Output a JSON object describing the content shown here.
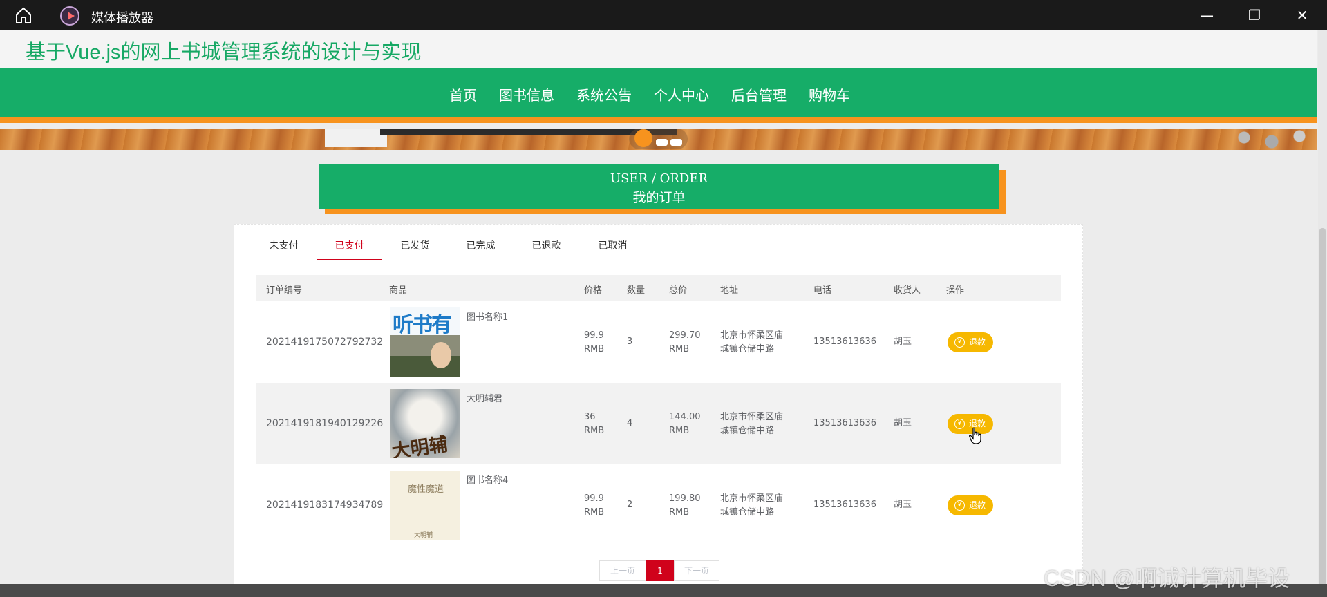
{
  "window": {
    "app_title": "媒体播放器",
    "min_glyph": "—",
    "max_glyph": "❐",
    "close_glyph": "✕"
  },
  "site": {
    "title": "基于Vue.js的网上书城管理系统的设计与实现"
  },
  "nav": {
    "items": [
      "首页",
      "图书信息",
      "系统公告",
      "个人中心",
      "后台管理",
      "购物车"
    ]
  },
  "section": {
    "en": "USER / ORDER",
    "cn": "我的订单"
  },
  "tabs": [
    "未支付",
    "已支付",
    "已发货",
    "已完成",
    "已退款",
    "已取消"
  ],
  "active_tab": "已支付",
  "table": {
    "headers": {
      "order_no": "订单编号",
      "product": "商品",
      "price": "价格",
      "qty": "数量",
      "total": "总价",
      "address": "地址",
      "phone": "电话",
      "receiver": "收货人",
      "action": "操作"
    },
    "rows": [
      {
        "order_no": "2021419175072792732",
        "cover_text": "听书有",
        "name": "图书名称1",
        "price": "99.9",
        "price_unit": "RMB",
        "qty": "3",
        "total": "299.70",
        "total_unit": "RMB",
        "addr1": "北京市怀柔区庙",
        "addr2": "城镇仓储中路",
        "phone": "13513613636",
        "receiver": "胡玉",
        "action": "退款"
      },
      {
        "order_no": "2021419181940129226",
        "cover_text": "大明辅君",
        "name": "大明辅君",
        "price": "36",
        "price_unit": "RMB",
        "qty": "4",
        "total": "144.00",
        "total_unit": "RMB",
        "addr1": "北京市怀柔区庙",
        "addr2": "城镇仓储中路",
        "phone": "13513613636",
        "receiver": "胡玉",
        "action": "退款"
      },
      {
        "order_no": "2021419183174934789",
        "cover_text": "魔性魔道",
        "cover_sub": "大明辅",
        "name": "图书名称4",
        "price": "99.9",
        "price_unit": "RMB",
        "qty": "2",
        "total": "199.80",
        "total_unit": "RMB",
        "addr1": "北京市怀柔区庙",
        "addr2": "城镇仓储中路",
        "phone": "13513613636",
        "receiver": "胡玉",
        "action": "退款"
      }
    ]
  },
  "pager": {
    "prev": "上一页",
    "current": "1",
    "next": "下一页"
  },
  "watermark": "CSDN @啊诚计算机毕设",
  "colors": {
    "brand_green": "#16ad68",
    "accent_orange": "#f7931e",
    "active_red": "#d0021b",
    "refund_yellow": "#f6b800"
  }
}
